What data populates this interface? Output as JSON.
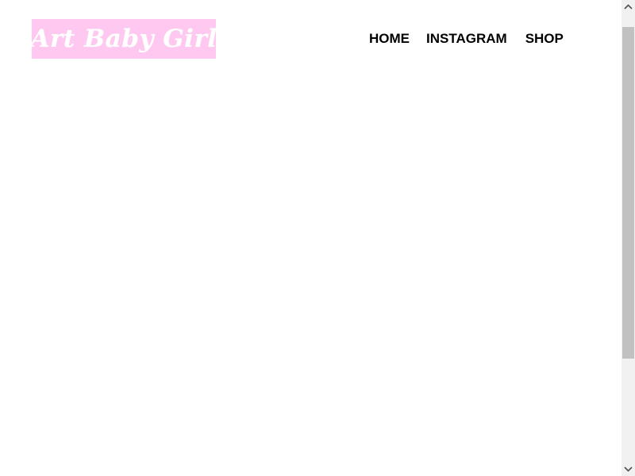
{
  "header": {
    "logo_text": "Art Baby Girl",
    "logo_bg_color": "#fec8f0",
    "logo_text_color": "#ffffff"
  },
  "nav": {
    "items": [
      {
        "label": "HOME"
      },
      {
        "label": "INSTAGRAM"
      },
      {
        "label": "SHOP"
      }
    ]
  },
  "scrollbar": {
    "up_icon": "chevron-up-icon",
    "down_icon": "chevron-down-icon"
  }
}
